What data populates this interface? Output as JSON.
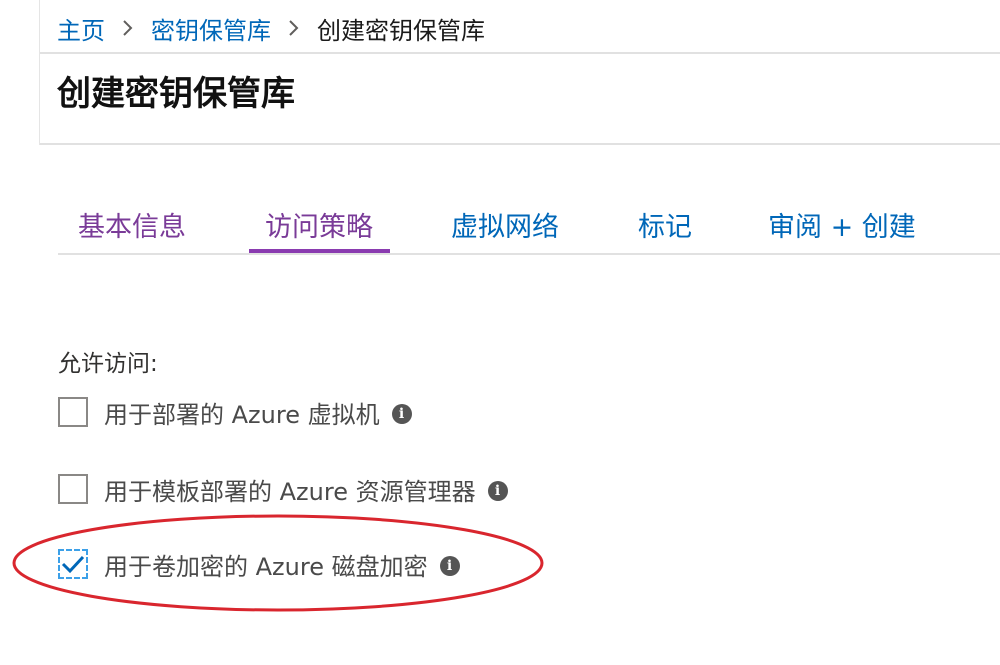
{
  "breadcrumb": {
    "items": [
      "主页",
      "密钥保管库"
    ],
    "current": "创建密钥保管库"
  },
  "page": {
    "title": "创建密钥保管库"
  },
  "tabs": [
    {
      "label": "基本信息",
      "state": "visited"
    },
    {
      "label": "访问策略",
      "state": "selected"
    },
    {
      "label": "虚拟网络",
      "state": "default"
    },
    {
      "label": "标记",
      "state": "default"
    },
    {
      "label": "审阅 + 创建",
      "state": "default"
    }
  ],
  "access": {
    "label": "允许访问:",
    "options": [
      {
        "label": "用于部署的 Azure 虚拟机",
        "checked": false
      },
      {
        "label": "用于模板部署的 Azure 资源管理器",
        "checked": false
      },
      {
        "label": "用于卷加密的 Azure 磁盘加密",
        "checked": true
      }
    ]
  },
  "colors": {
    "link": "#0067b8",
    "visited_tab": "#7a3b98",
    "selected_underline": "#8a3bb0",
    "check": "#0067b8",
    "annotation": "#d9262e"
  }
}
